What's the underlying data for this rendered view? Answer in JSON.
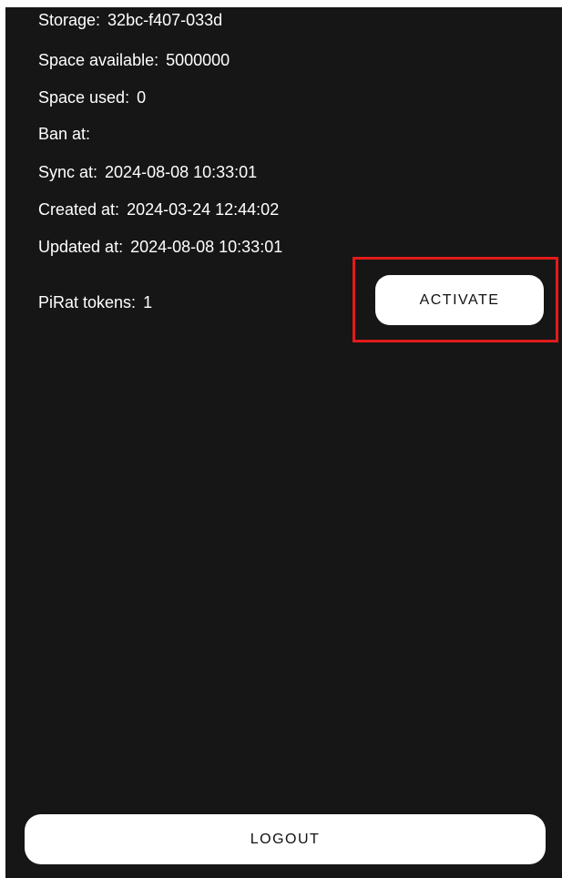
{
  "account_info": {
    "storage": {
      "label": "Storage:",
      "value": "32bc-f407-033d"
    },
    "space_available": {
      "label": "Space available:",
      "value": "5000000"
    },
    "space_used": {
      "label": "Space used:",
      "value": "0"
    },
    "ban_at": {
      "label": "Ban at:",
      "value": ""
    },
    "sync_at": {
      "label": "Sync at:",
      "value": "2024-08-08 10:33:01"
    },
    "created_at": {
      "label": "Created at:",
      "value": "2024-03-24 12:44:02"
    },
    "updated_at": {
      "label": "Updated at:",
      "value": "2024-08-08 10:33:01"
    },
    "pirat_tokens": {
      "label": "PiRat tokens:",
      "value": "1"
    }
  },
  "actions": {
    "activate_label": "ACTIVATE",
    "logout_label": "LOGOUT"
  },
  "colors": {
    "background": "#161616",
    "text": "#ffffff",
    "button_bg": "#ffffff",
    "button_text": "#111111",
    "highlight": "#e21b1b"
  }
}
